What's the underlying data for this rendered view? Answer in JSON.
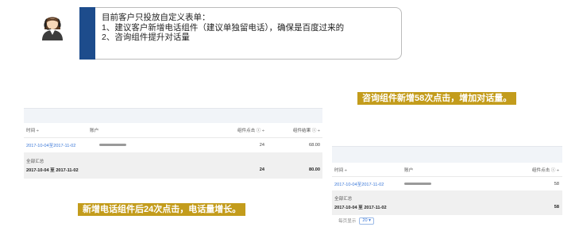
{
  "note": {
    "lines": [
      "目前客户只投放自定义表单：",
      "1、建议客户新增电话组件（建议单独留电话），确保是百度过来的",
      "2、咨询组件提升对话量"
    ]
  },
  "callouts": {
    "right": "咨询组件新增58次点击，增加对话量。",
    "left": "新增电话组件后24次点击，电话量增长。"
  },
  "colors": {
    "accent": "#1d4c8c",
    "callout": "#c39c1c",
    "link": "#3b78d8"
  },
  "left_table": {
    "headers": {
      "time": "时间 ÷",
      "account": "账户",
      "clicks": "组件点击 ⓘ ÷",
      "calls": "组件结果 ⓘ ÷"
    },
    "row": {
      "date": "2017-10-04至2017-11-02",
      "clicks": "24",
      "calls": "68.00"
    },
    "summary": {
      "label": "全部汇总",
      "date": "2017-10-04 至 2017-11-02",
      "clicks": "24",
      "calls": "80.00"
    }
  },
  "right_table": {
    "headers": {
      "time": "时间 ÷",
      "account": "账户",
      "clicks": "组件点击 ⓘ ÷"
    },
    "row": {
      "date": "2017-10-04至2017-11-02",
      "clicks": "58"
    },
    "summary": {
      "label": "全部汇总",
      "date": "2017-10-04 至 2017-11-02",
      "clicks": "58"
    },
    "pager": {
      "label": "每页显示",
      "size": "20 ▾"
    }
  }
}
